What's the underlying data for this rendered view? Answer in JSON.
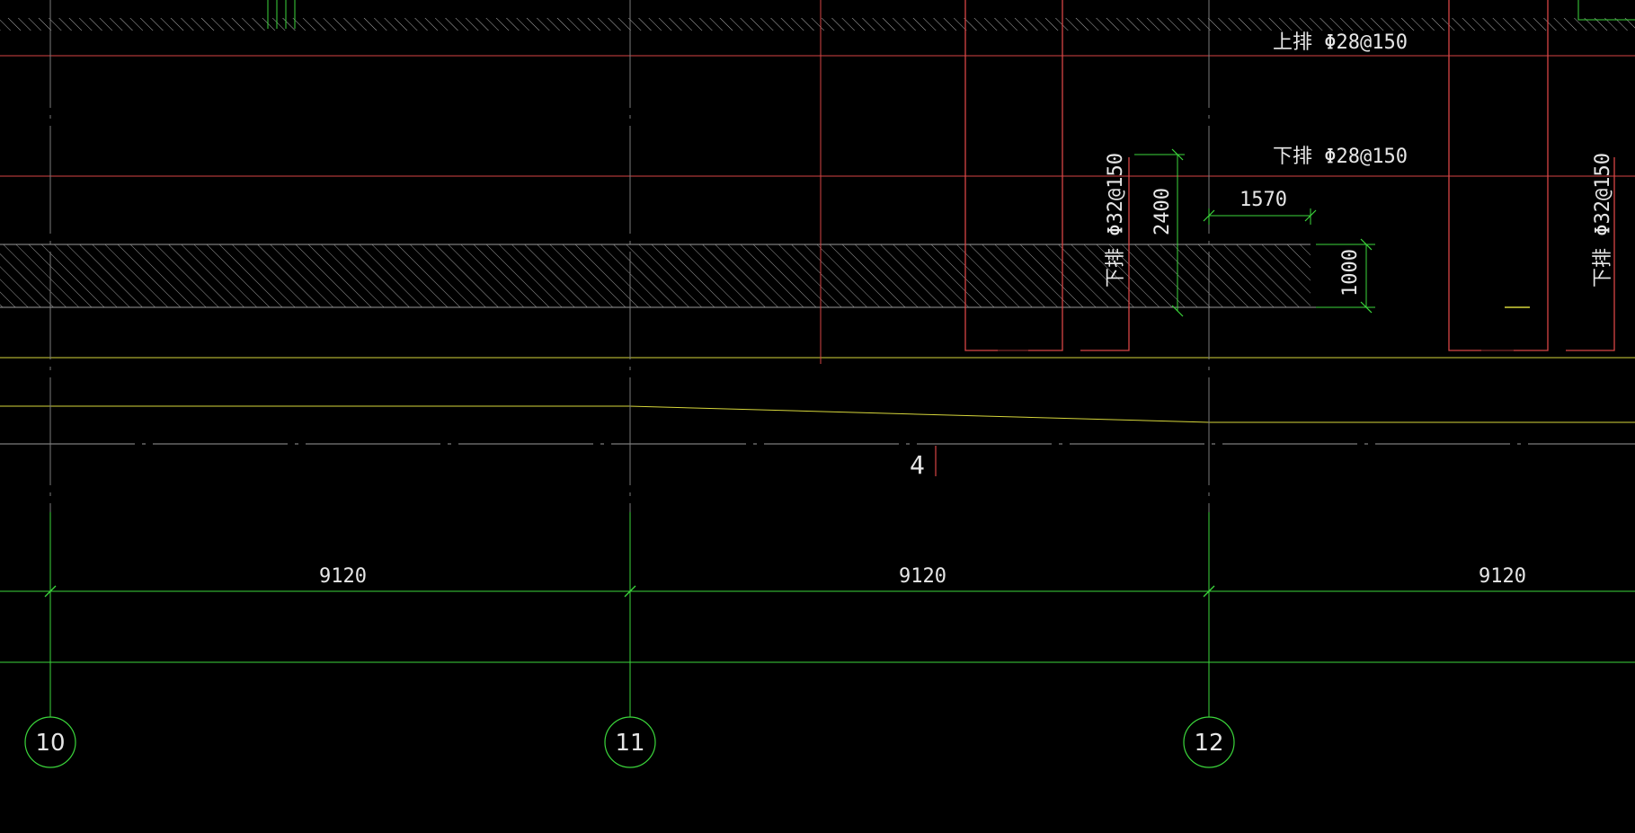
{
  "drawing": {
    "background_color": "#000000",
    "colors": {
      "axis_green": "#3bd63b",
      "beam_red": "#d64545",
      "text_white": "#e6e6e6",
      "hatch_white": "#9a9a9a",
      "yellow_line": "#d6d63b",
      "grid_gray": "#7a7a7a"
    },
    "axes": [
      {
        "label": "10"
      },
      {
        "label": "11"
      },
      {
        "label": "12"
      }
    ],
    "spans": [
      {
        "value": "9120"
      },
      {
        "value": "9120"
      },
      {
        "value": "9120"
      }
    ],
    "rebar_labels": {
      "top_main": "上排 Φ28@150",
      "bottom_main": "下排 Φ28@150",
      "vertical_left": "下排 Φ32@150",
      "vertical_right": "下排 Φ32@150"
    },
    "dimensions": {
      "height_2400": "2400",
      "width_1570": "1570",
      "height_1000": "1000"
    },
    "section_mark": "4"
  }
}
